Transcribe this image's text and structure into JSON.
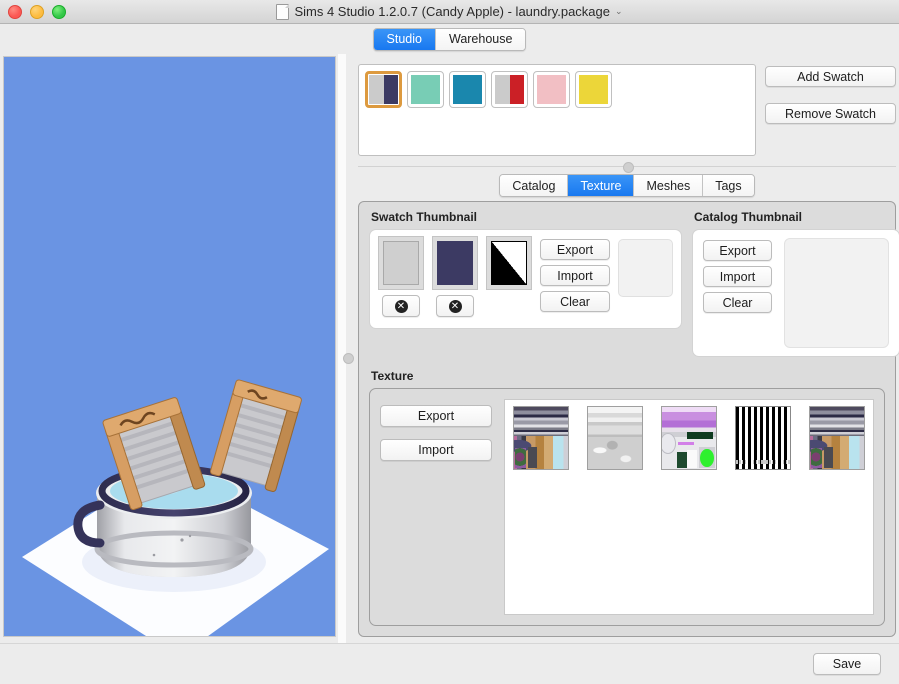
{
  "window": {
    "title": "Sims 4 Studio 1.2.0.7 (Candy Apple)  - laundry.package",
    "title_chevron": "⌄",
    "doc_icon": "document-icon"
  },
  "mode_tabs": {
    "items": [
      {
        "label": "Studio",
        "active": true
      },
      {
        "label": "Warehouse",
        "active": false
      }
    ]
  },
  "viewport": {
    "name": "3d-preview",
    "background_color": "#6a94e3",
    "object": "laundry washtub with washboards",
    "floor_color": "#ffffff"
  },
  "swatches": {
    "items": [
      {
        "name": "swatch-navy-gray",
        "type": "split",
        "colors": [
          "#cbcbcb",
          "#3c3a63"
        ],
        "selected": true
      },
      {
        "name": "swatch-mint",
        "type": "solid",
        "colors": [
          "#78cdb5"
        ],
        "selected": false
      },
      {
        "name": "swatch-teal",
        "type": "solid",
        "colors": [
          "#1a87ad"
        ],
        "selected": false
      },
      {
        "name": "swatch-red-gray",
        "type": "split",
        "colors": [
          "#cbcbcb",
          "#cb2026"
        ],
        "selected": false
      },
      {
        "name": "swatch-pink",
        "type": "solid",
        "colors": [
          "#f2bfc4"
        ],
        "selected": false
      },
      {
        "name": "swatch-yellow",
        "type": "solid",
        "colors": [
          "#ecd639"
        ],
        "selected": false
      }
    ],
    "add_label": "Add Swatch",
    "remove_label": "Remove Swatch",
    "selection_border_color": "#dd9a3f"
  },
  "content_tabs": {
    "items": [
      {
        "label": "Catalog",
        "active": false
      },
      {
        "label": "Texture",
        "active": true
      },
      {
        "label": "Meshes",
        "active": false
      },
      {
        "label": "Tags",
        "active": false
      }
    ]
  },
  "swatch_thumbnail": {
    "title": "Swatch Thumbnail",
    "thumbs": [
      {
        "name": "swatch-thumb-gray",
        "style": "gray",
        "has_delete": true
      },
      {
        "name": "swatch-thumb-navy",
        "style": "navy",
        "has_delete": true
      },
      {
        "name": "swatch-thumb-diagonal",
        "style": "diag",
        "has_delete": false
      }
    ],
    "delete_icon": "✕",
    "buttons": [
      {
        "label": "Export",
        "name": "swatch-export-button"
      },
      {
        "label": "Import",
        "name": "swatch-import-button"
      },
      {
        "label": "Clear",
        "name": "swatch-clear-button"
      }
    ]
  },
  "catalog_thumbnail": {
    "title": "Catalog Thumbnail",
    "buttons": [
      {
        "label": "Export",
        "name": "catalog-export-button"
      },
      {
        "label": "Import",
        "name": "catalog-import-button"
      },
      {
        "label": "Clear",
        "name": "catalog-clear-button"
      }
    ],
    "preview_empty": true
  },
  "texture": {
    "title": "Texture",
    "buttons": [
      {
        "label": "Export",
        "name": "texture-export-button"
      },
      {
        "label": "Import",
        "name": "texture-import-button"
      }
    ],
    "thumbs": [
      {
        "name": "texture-thumb-diffuse",
        "style": "tex-a"
      },
      {
        "name": "texture-thumb-specular",
        "style": "tex-b"
      },
      {
        "name": "texture-thumb-overlay",
        "style": "tex-c"
      },
      {
        "name": "texture-thumb-stripes",
        "style": "tex-d"
      },
      {
        "name": "texture-thumb-diffuse-2",
        "style": "tex-a"
      }
    ]
  },
  "footer": {
    "save_label": "Save"
  }
}
